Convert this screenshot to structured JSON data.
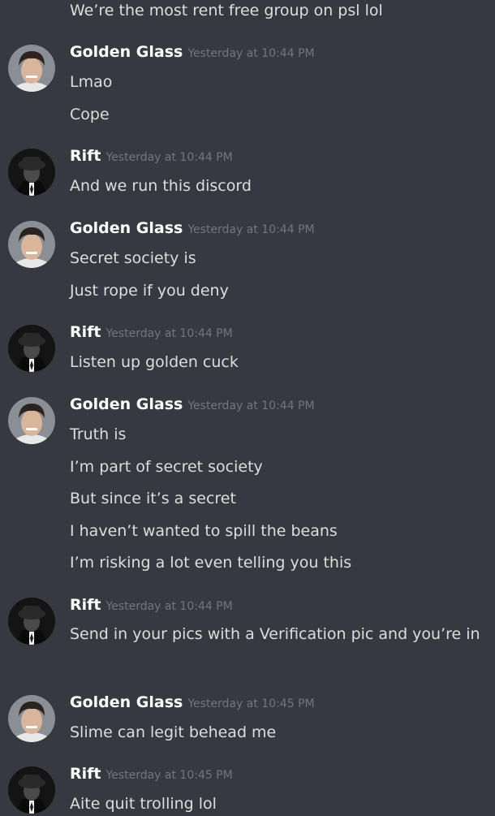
{
  "top_line": "We’re the most rent free group on psl lol",
  "messages": [
    {
      "author": "Golden Glass",
      "timestamp": "Yesterday at 10:44 PM",
      "avatar": "golden",
      "lines": [
        "Lmao",
        "Cope"
      ]
    },
    {
      "author": "Rift",
      "timestamp": "Yesterday at 10:44 PM",
      "avatar": "rift",
      "lines": [
        "And we run this discord"
      ]
    },
    {
      "author": "Golden Glass",
      "timestamp": "Yesterday at 10:44 PM",
      "avatar": "golden",
      "lines": [
        "Secret society is",
        "Just rope if you deny"
      ]
    },
    {
      "author": "Rift",
      "timestamp": "Yesterday at 10:44 PM",
      "avatar": "rift",
      "lines": [
        "Listen up golden cuck"
      ]
    },
    {
      "author": "Golden Glass",
      "timestamp": "Yesterday at 10:44 PM",
      "avatar": "golden",
      "lines": [
        "Truth is",
        "I’m part of secret society",
        "But since it’s a secret",
        "I haven’t wanted to spill the beans",
        "I’m risking a lot even telling you this"
      ]
    },
    {
      "author": "Rift",
      "timestamp": "Yesterday at 10:44 PM",
      "avatar": "rift",
      "lines": [
        "Send in your pics with a Verification pic and you’re in"
      ]
    },
    {
      "author": "Golden Glass",
      "timestamp": "Yesterday at 10:45 PM",
      "avatar": "golden",
      "lines": [
        "Slime can legit behead me"
      ]
    },
    {
      "author": "Rift",
      "timestamp": "Yesterday at 10:45 PM",
      "avatar": "rift",
      "lines": [
        "Aite quit trolling lol"
      ]
    }
  ]
}
